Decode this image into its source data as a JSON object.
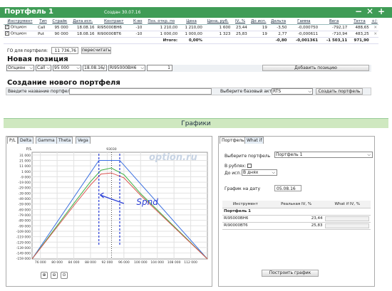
{
  "window": {
    "title": "Портфель 1",
    "created": "Создан 30.07.16",
    "controls": [
      "−",
      "✕",
      "+"
    ]
  },
  "positions": {
    "headers": [
      "Инструмент",
      "Тип",
      "Страйк",
      "Дата исп.",
      "Контракт",
      "К-во",
      "Поз. откр. по",
      "Цена",
      "Цена, руб.",
      "IV, %",
      "До исп.",
      "Дельта",
      "Гамма",
      "Вега",
      "Тетта",
      "+/-"
    ],
    "rows": [
      {
        "instr": "Опцион",
        "type": "Call",
        "strike": "95 000",
        "date": "18.08.16",
        "contract": "RI95000BH6",
        "qty": "-10",
        "open": "1 210,00",
        "price": "1 210,00",
        "rub": "1 600",
        "iv": "23,44",
        "days": "19",
        "delta": "-3,50",
        "gamma": "-0,000750",
        "vega": "-792,17",
        "theta": "488,65"
      },
      {
        "instr": "Опцион",
        "type": "Put",
        "strike": "90 000",
        "date": "18.08.16",
        "contract": "RI90000BT6",
        "qty": "-10",
        "open": "1 000,00",
        "price": "1 000,00",
        "rub": "1 323",
        "iv": "25,83",
        "days": "19",
        "delta": "2,77",
        "gamma": "-0,000611",
        "vega": "-710,94",
        "theta": "483,25"
      }
    ],
    "totals": {
      "label": "Итого:",
      "open": "0,00%",
      "delta": "-0,80",
      "gamma": "-0,001361",
      "vega": "-1 503,11",
      "theta": "971,90"
    }
  },
  "go": {
    "label": "ГО для портфеля:",
    "value": "11 736,76",
    "button": "пересчитать"
  },
  "new_position": {
    "title": "Новая позиция",
    "instr": "Опцион",
    "type": "Call",
    "strike": "95 000",
    "date": "18.08.16/",
    "contract": "RI95000BH6",
    "qty": "1",
    "button": "Добавить позицию"
  },
  "new_portfolio": {
    "title": "Создание нового портфеля",
    "name_label": "Введите название портфеля",
    "asset_label": "Выберите базовый актив",
    "asset": "RTS",
    "button": "Создать портфель"
  },
  "graphs": {
    "title": "Графики",
    "tabs": [
      "P/L",
      "Delta",
      "Gamma",
      "Theta",
      "Vega"
    ],
    "watermark": "option.ru",
    "annotation": "Spnd"
  },
  "right": {
    "tabs": [
      "Портфель",
      "What if"
    ],
    "portfolio_label": "Выберите портфель",
    "portfolio_value": "Портфель 1",
    "rub_label": "В рублях:",
    "exp_label": "До исп.:",
    "exp_value": "В днях",
    "date_label": "График на дату",
    "date_value": "05.08.16",
    "table_headers": [
      "Инструмент",
      "Реальная IV, %",
      "What if IV, %"
    ],
    "group": "Портфель 1",
    "iv_rows": [
      {
        "name": "RI95000BH6",
        "iv": "23,44"
      },
      {
        "name": "RI90000BT6",
        "iv": "25,83"
      }
    ],
    "button": "Построить график"
  },
  "chart_data": {
    "type": "line",
    "xlabel": "",
    "ylabel": "P/L",
    "x_ticks": [
      "76 000",
      "80 000",
      "84 000",
      "88 000",
      "92 000",
      "96 000",
      "100 000",
      "104 000",
      "108 000",
      "112 000"
    ],
    "y_ticks": [
      "31 000",
      "21 000",
      "11 000",
      "1 000",
      "-9 000",
      "-19 000",
      "-29 000",
      "-39 000",
      "-49 000",
      "-59 000",
      "-69 000",
      "-79 000",
      "-89 000",
      "-99 000",
      "-109 000",
      "-119 000",
      "-129 000",
      "-139 000",
      "-149 000",
      "-159 000"
    ],
    "marker_label": "93030",
    "xlim": [
      74000,
      116000
    ],
    "ylim": [
      -160000,
      36000
    ],
    "series": [
      {
        "color": "#3a6fe0",
        "x": [
          74000,
          90000,
          95000,
          116000
        ],
        "y": [
          -160000,
          21000,
          21000,
          -160000
        ]
      },
      {
        "color": "#3cb043",
        "x": [
          74000,
          84000,
          88000,
          90500,
          93000,
          96000,
          100000,
          116000
        ],
        "y": [
          -160000,
          -58000,
          -18000,
          3000,
          7000,
          -5000,
          -40000,
          -160000
        ]
      },
      {
        "color": "#d9534f",
        "x": [
          74000,
          84000,
          88000,
          90500,
          93000,
          96000,
          100000,
          116000
        ],
        "y": [
          -160000,
          -62000,
          -24000,
          -4000,
          -2000,
          -11000,
          -43000,
          -160000
        ]
      }
    ]
  }
}
